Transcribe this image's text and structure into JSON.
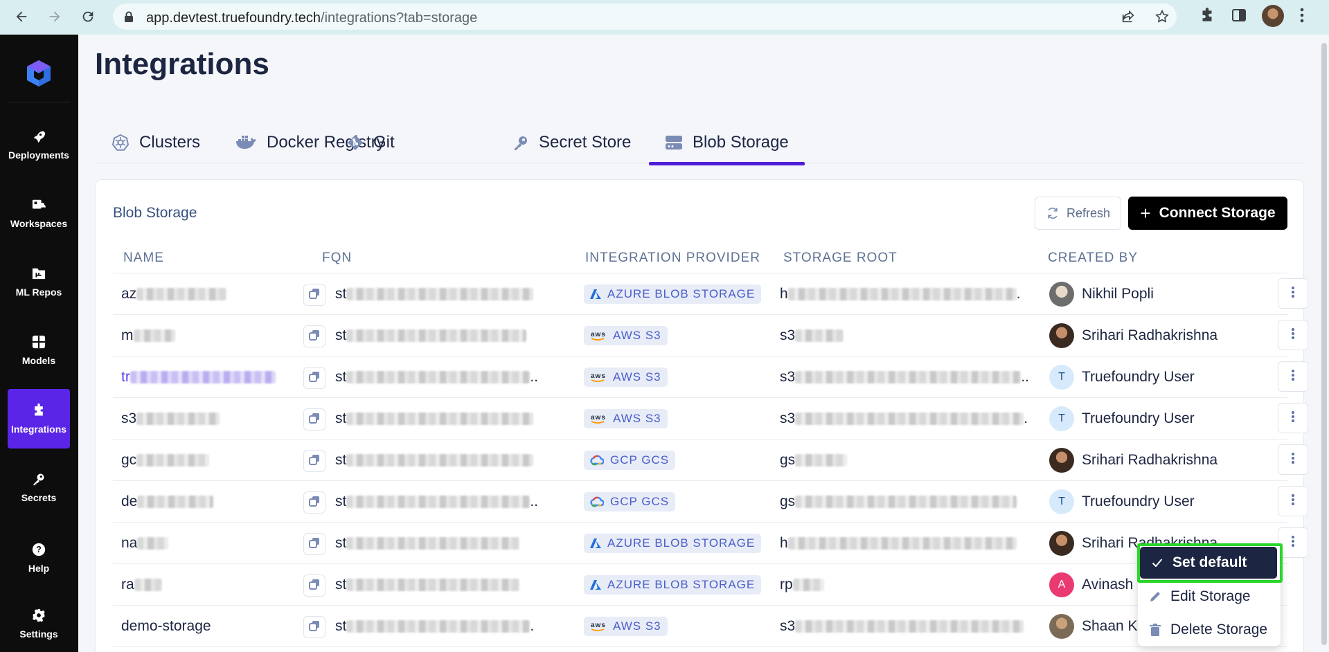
{
  "browser": {
    "url_host": "app.devtest.truefoundry.tech",
    "url_path": "/integrations?tab=storage"
  },
  "sidebar": {
    "items": [
      {
        "label": "Deployments",
        "icon": "rocket-icon"
      },
      {
        "label": "Workspaces",
        "icon": "workspace-icon"
      },
      {
        "label": "ML Repos",
        "icon": "folder-icon"
      },
      {
        "label": "Models",
        "icon": "grid-icon"
      },
      {
        "label": "Integrations",
        "icon": "puzzle-icon",
        "active": true
      },
      {
        "label": "Secrets",
        "icon": "key-icon"
      },
      {
        "label": "Help",
        "icon": "help-icon"
      },
      {
        "label": "Settings",
        "icon": "gear-icon"
      }
    ]
  },
  "page": {
    "title": "Integrations"
  },
  "tabs": [
    {
      "label": "Clusters"
    },
    {
      "label": "Docker Registry"
    },
    {
      "label": "Git"
    },
    {
      "label": "Secret Store"
    },
    {
      "label": "Blob Storage",
      "active": true
    }
  ],
  "card": {
    "title": "Blob Storage",
    "refresh_label": "Refresh",
    "connect_label": "Connect Storage"
  },
  "table": {
    "headers": [
      "NAME",
      "FQN",
      "INTEGRATION PROVIDER",
      "STORAGE ROOT",
      "CREATED BY"
    ],
    "rows": [
      {
        "name": "az",
        "fqn": "st",
        "provider": "AZURE BLOB STORAGE",
        "root": "h",
        "creator": "Nikhil Popli"
      },
      {
        "name": "m",
        "fqn": "st",
        "provider": "AWS S3",
        "root": "s3",
        "creator": "Srihari Radhakrishna"
      },
      {
        "name": "tr",
        "fqn": "st",
        "provider": "AWS S3",
        "root": "s3",
        "creator": "Truefoundry User",
        "initial": "T"
      },
      {
        "name": "s3",
        "fqn": "st",
        "provider": "AWS S3",
        "root": "s3",
        "creator": "Truefoundry User",
        "initial": "T"
      },
      {
        "name": "gc",
        "fqn": "st",
        "provider": "GCP GCS",
        "root": "gs",
        "creator": "Srihari Radhakrishna"
      },
      {
        "name": "de",
        "fqn": "st",
        "provider": "GCP GCS",
        "root": "gs",
        "creator": "Truefoundry User",
        "initial": "T"
      },
      {
        "name": "na",
        "fqn": "st",
        "provider": "AZURE BLOB STORAGE",
        "root": "h",
        "creator": "Srihari Radhakrishna"
      },
      {
        "name": "ra",
        "fqn": "st",
        "provider": "AZURE BLOB STORAGE",
        "root": "rp",
        "creator": "Avinash",
        "initial": "A"
      },
      {
        "name": "demo-storage",
        "fqn": "st",
        "provider": "AWS S3",
        "root": "s3",
        "creator": "Shaan Ku"
      }
    ]
  },
  "menu": {
    "items": [
      "Set default",
      "Edit Storage",
      "Delete Storage"
    ]
  },
  "colors": {
    "accent": "#5b25e8",
    "tab_underline": "#4f1fd8",
    "focus_ring": "#2ad62a",
    "badge_text": "#4a5dc9"
  }
}
